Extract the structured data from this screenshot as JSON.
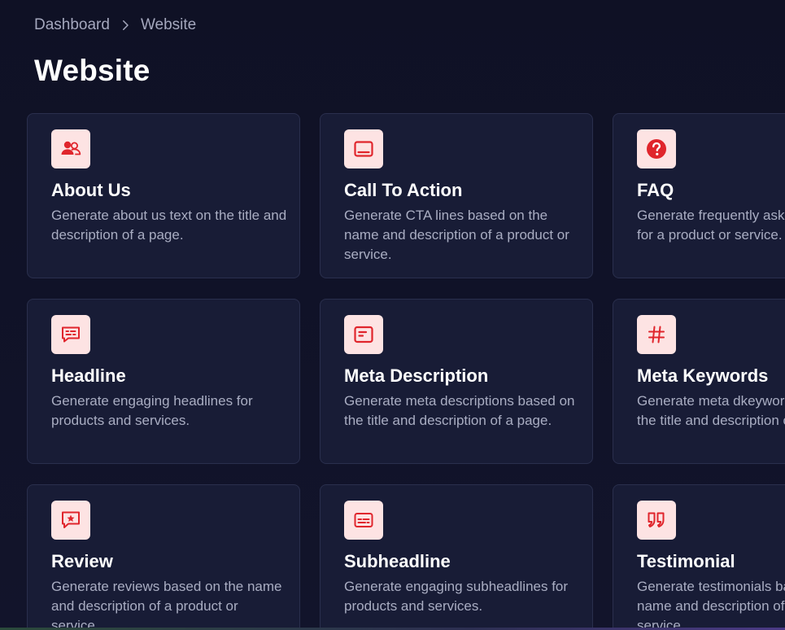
{
  "breadcrumb": {
    "parent": "Dashboard",
    "current": "Website"
  },
  "page_title": "Website",
  "colors": {
    "background": "#11132a",
    "card": "#181c36",
    "card_border": "#2a2f4d",
    "icon_bg": "#fde3e3",
    "icon_fg": "#e0252c",
    "title": "#ffffff",
    "description": "#a9adc2"
  },
  "cards": [
    {
      "icon": "users-icon",
      "title": "About Us",
      "description": "Generate about us text on the title and description of a page."
    },
    {
      "icon": "monitor-icon",
      "title": "Call To Action",
      "description": "Generate CTA lines based on the name and description of a product or service."
    },
    {
      "icon": "question-icon",
      "title": "FAQ",
      "description": "Generate frequently asked questions for a product or service."
    },
    {
      "icon": "message-icon",
      "title": "Headline",
      "description": "Generate engaging headlines for products and services."
    },
    {
      "icon": "document-icon",
      "title": "Meta Description",
      "description": "Generate meta descriptions based on the title and description of a page."
    },
    {
      "icon": "hashtag-icon",
      "title": "Meta Keywords",
      "description": "Generate meta dkeywords based on the title and description of a page."
    },
    {
      "icon": "review-icon",
      "title": "Review",
      "description": "Generate reviews based on the name and description of a product or service."
    },
    {
      "icon": "subtitle-icon",
      "title": "Subheadline",
      "description": "Generate engaging subheadlines for products and services."
    },
    {
      "icon": "quote-icon",
      "title": "Testimonial",
      "description": "Generate testimonials based on the name and description of a product or service."
    }
  ]
}
